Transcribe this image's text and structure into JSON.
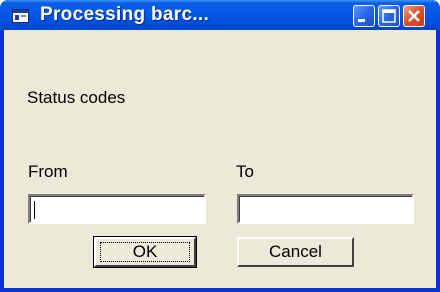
{
  "window": {
    "title": "Processing barc...",
    "controls": {
      "minimize": "minimize",
      "maximize": "maximize",
      "close": "close"
    }
  },
  "form": {
    "status_label": "Status codes",
    "from_label": "From",
    "to_label": "To",
    "from_value": "",
    "to_value": "",
    "ok_label": "OK",
    "cancel_label": "Cancel"
  },
  "icons": {
    "app": "form-window-icon",
    "minimize": "minimize-icon",
    "maximize": "maximize-icon",
    "close": "close-icon"
  },
  "colors": {
    "titlebar": "#0058e6",
    "client_bg": "#ece9d8",
    "close_button": "#e0542d"
  }
}
